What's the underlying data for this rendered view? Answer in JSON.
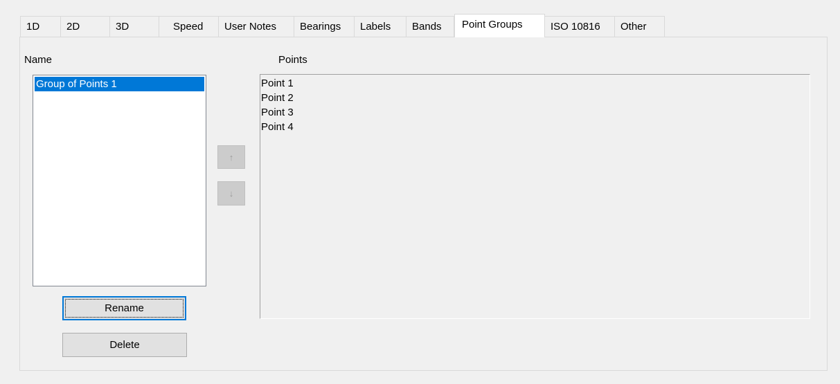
{
  "tabs": [
    {
      "label": "1D",
      "active": false
    },
    {
      "label": "2D",
      "active": false
    },
    {
      "label": "3D",
      "active": false
    },
    {
      "label": "Speed",
      "active": false
    },
    {
      "label": "User Notes",
      "active": false
    },
    {
      "label": "Bearings",
      "active": false
    },
    {
      "label": "Labels",
      "active": false
    },
    {
      "label": "Bands",
      "active": false
    },
    {
      "label": "Point Groups",
      "active": true
    },
    {
      "label": "ISO 10816",
      "active": false
    },
    {
      "label": "Other",
      "active": false
    }
  ],
  "point_groups": {
    "name_label": "Name",
    "points_label": "Points",
    "groups": [
      {
        "label": "Group of Points 1",
        "selected": true
      }
    ],
    "points": [
      "Point 1",
      "Point 2",
      "Point 3",
      "Point 4"
    ],
    "move_up_icon": "up-arrow-icon",
    "move_down_icon": "down-arrow-icon",
    "move_up_glyph": "↑",
    "move_down_glyph": "↓",
    "rename_label": "Rename",
    "delete_label": "Delete"
  },
  "colors": {
    "selection": "#0078d7",
    "window_bg": "#f0f0f0"
  }
}
